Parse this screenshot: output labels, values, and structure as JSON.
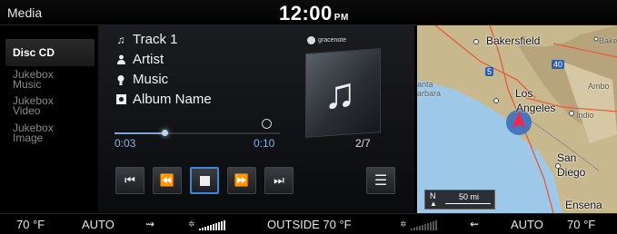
{
  "header": {
    "title": "Media",
    "time": "12:00",
    "ampm": "PM"
  },
  "sidebar": {
    "items": [
      {
        "label": "Disc CD",
        "active": true
      },
      {
        "label": "Jukebox Music",
        "line1": "Jukebox",
        "line2": "Music"
      },
      {
        "label": "Jukebox Video",
        "line1": "Jukebox",
        "line2": "Video"
      },
      {
        "label": "Jukebox Image",
        "line1": "Jukebox",
        "line2": "Image"
      }
    ]
  },
  "track": {
    "title": "Track 1",
    "artist": "Artist",
    "genre": "Music",
    "album": "Album Name",
    "elapsed": "0:03",
    "duration": "0:10",
    "progress_fraction": 0.3,
    "position": "2/7",
    "provider": "gracenote"
  },
  "controls": [
    {
      "name": "previous-track",
      "glyph": "⏮"
    },
    {
      "name": "rewind",
      "glyph": "⏪"
    },
    {
      "name": "stop",
      "glyph": ""
    },
    {
      "name": "fast-forward",
      "glyph": "⏩"
    },
    {
      "name": "next-track",
      "glyph": "⏭"
    }
  ],
  "list_button_glyph": "☰",
  "map": {
    "labels": {
      "bakersfield": "Bakersfield",
      "bake": "Bake",
      "santa": "anta",
      "barbara": "arbara",
      "los": "Los",
      "angeles": "Angeles",
      "ambo": "Ambo",
      "indio": "Indio",
      "san": "San",
      "diego": "Diego",
      "ensena": "Ensena",
      "route5": "5",
      "route40": "40"
    },
    "scale": {
      "north": "N",
      "distance": "50 mi"
    },
    "colors": {
      "land": "#c9b98f",
      "water": "#9ec8e8",
      "road": "#e85a3a"
    }
  },
  "climate": {
    "left_temp": "70 °F",
    "left_mode": "AUTO",
    "outside": "OUTSIDE 70 °F",
    "right_mode": "AUTO",
    "right_temp": "70 °F"
  }
}
